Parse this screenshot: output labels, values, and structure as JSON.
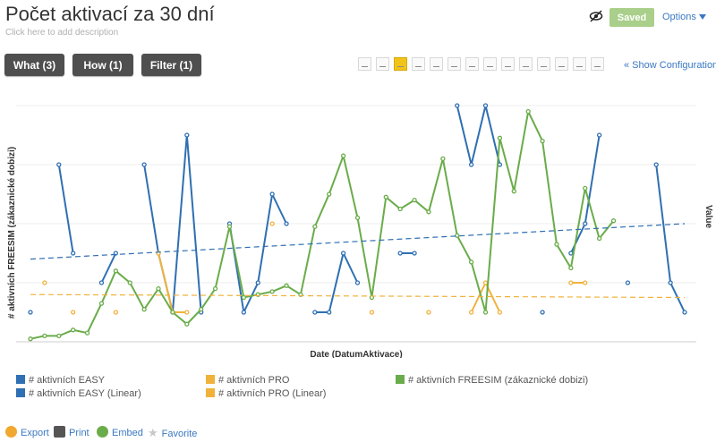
{
  "header": {
    "title": "Počet aktivací za 30 dní",
    "description_placeholder": "Click here to add description",
    "saved_label": "Saved",
    "options_label": "Options"
  },
  "filters": {
    "what_label": "What (3)",
    "how_label": "How (1)",
    "filter_label": "Filter (1)"
  },
  "toolbar": {
    "show_config_label": "« Show Configuration",
    "chart_types": [
      "table-numbers-icon",
      "table-grid-icon",
      "line-chart-icon",
      "line-chart-multi-icon",
      "area-chart-icon",
      "bar-chart-icon",
      "stacked-bar-icon",
      "column-chart-icon",
      "histogram-icon",
      "funnel-icon",
      "pie-chart-icon",
      "donut-chart-icon",
      "scatter-icon",
      "bubble-icon"
    ],
    "active_index": 2
  },
  "colors": {
    "easy": "#2f6fb3",
    "pro": "#f0b23b",
    "freesim": "#6aac4a",
    "easy_linear": "#2f6fb3",
    "pro_linear": "#f0b23b"
  },
  "chart_data": {
    "type": "line",
    "xlabel": "Date (DatumAktivace)",
    "ylabel": "# aktivních FREESIM (zákaznické dobizi)",
    "ylabel_right": "Value",
    "ylim": [
      0,
      8
    ],
    "grid": true,
    "legend_position": "bottom",
    "series": [
      {
        "name": "# aktivních EASY",
        "color_key": "easy",
        "values": [
          1,
          null,
          6,
          3,
          null,
          2,
          3,
          null,
          6,
          3,
          1,
          7,
          1,
          null,
          4,
          1,
          2,
          5,
          4,
          null,
          1,
          1,
          3,
          2,
          null,
          null,
          3,
          3,
          null,
          null,
          8,
          6,
          8,
          6,
          null,
          null,
          1,
          null,
          3,
          4,
          7,
          null,
          2,
          null,
          6,
          2,
          1
        ]
      },
      {
        "name": "# aktivních PRO",
        "color_key": "pro",
        "values": [
          null,
          2,
          null,
          1,
          null,
          null,
          1,
          null,
          null,
          3,
          1,
          1,
          null,
          null,
          null,
          null,
          null,
          4,
          null,
          null,
          null,
          null,
          null,
          null,
          1,
          null,
          null,
          null,
          1,
          null,
          null,
          1,
          2,
          1,
          null,
          null,
          null,
          null,
          2,
          2,
          null,
          null,
          null,
          null,
          null,
          null,
          null
        ]
      },
      {
        "name": "# aktivních FREESIM (zákaznické dobizi)",
        "color_key": "freesim",
        "values": [
          0.1,
          0.2,
          0.2,
          0.4,
          0.3,
          1.3,
          2.4,
          2.0,
          1.1,
          1.8,
          1.0,
          0.6,
          1.1,
          1.8,
          3.9,
          1.5,
          1.6,
          1.7,
          1.9,
          1.6,
          3.9,
          5.0,
          6.3,
          4.2,
          1.5,
          4.9,
          4.5,
          4.8,
          4.4,
          6.2,
          3.6,
          2.7,
          1.0,
          6.9,
          5.1,
          7.8,
          6.8,
          3.3,
          2.5,
          5.2,
          3.5,
          4.1,
          null,
          null,
          null,
          null,
          null
        ]
      },
      {
        "name": "# aktivních EASY (Linear)",
        "color_key": "easy_linear",
        "dashed": true,
        "values": [
          2.8,
          4.0
        ]
      },
      {
        "name": "# aktivních PRO (Linear)",
        "color_key": "pro_linear",
        "dashed": true,
        "values": [
          1.6,
          1.5
        ]
      }
    ]
  },
  "legend": {
    "easy": "# aktivních EASY",
    "pro": "# aktivních PRO",
    "freesim": "# aktivních FREESIM (zákaznické dobizi)",
    "easy_linear": "# aktivních EASY (Linear)",
    "pro_linear": "# aktivních PRO (Linear)"
  },
  "footer": {
    "export_label": "Export",
    "print_label": "Print",
    "embed_label": "Embed",
    "favorite_label": "Favorite"
  }
}
